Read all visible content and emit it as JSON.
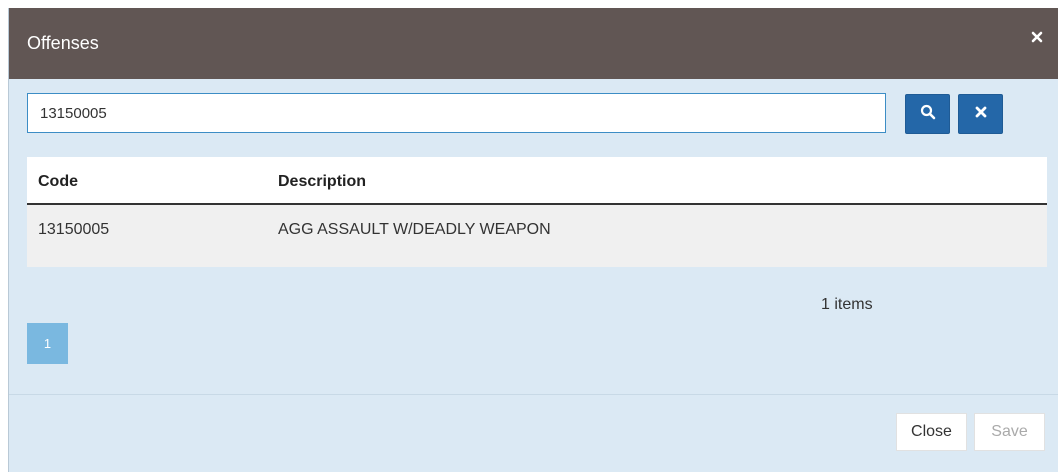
{
  "dialog": {
    "title": "Offenses",
    "close_icon": "close-icon"
  },
  "search": {
    "value": "13150005",
    "search_icon": "search-icon",
    "clear_icon": "clear-icon"
  },
  "grid": {
    "columns": [
      "Code",
      "Description"
    ],
    "rows": [
      {
        "code": "13150005",
        "description": "AGG ASSAULT W/DEADLY WEAPON"
      }
    ]
  },
  "pagination": {
    "items_text": "1 items",
    "current_page": "1"
  },
  "footer": {
    "close_label": "Close",
    "save_label": "Save"
  },
  "colors": {
    "header_bg": "#615654",
    "body_bg": "#dbe9f4",
    "primary_button": "#2467a8",
    "active_page": "#7ab8e0"
  }
}
